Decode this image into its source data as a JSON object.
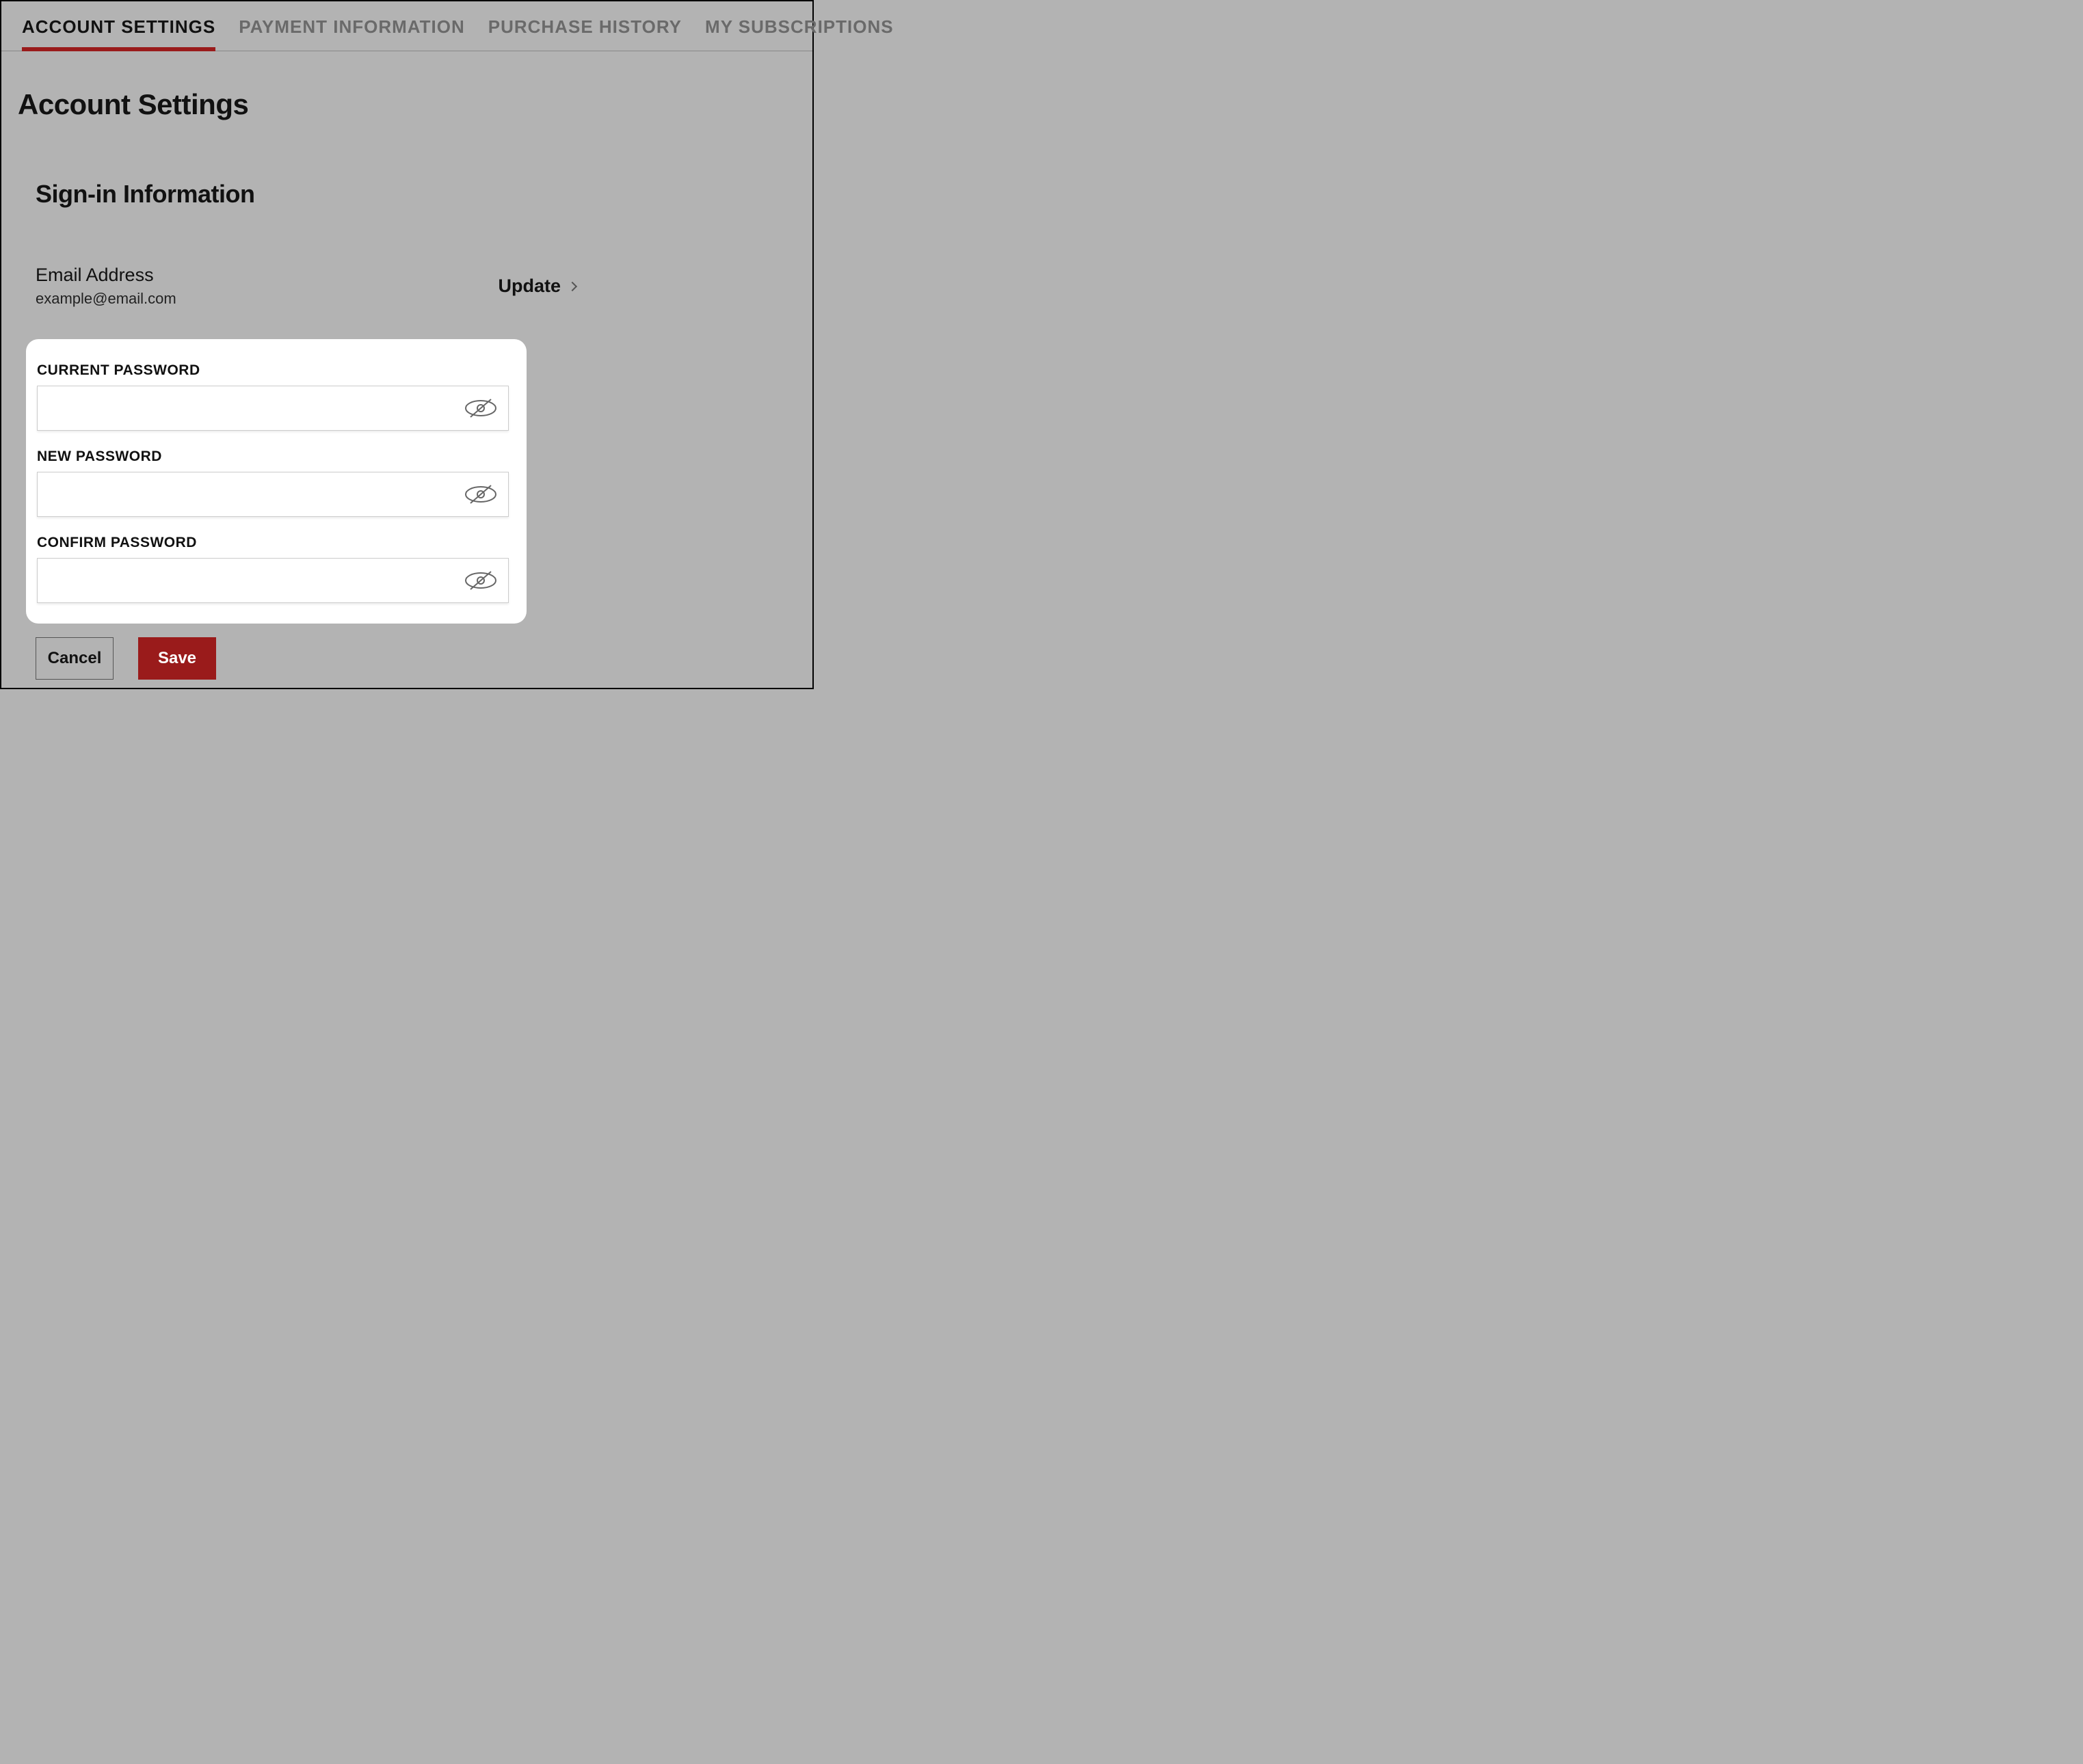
{
  "tabs": [
    {
      "label": "ACCOUNT SETTINGS",
      "active": true
    },
    {
      "label": "PAYMENT INFORMATION",
      "active": false
    },
    {
      "label": "PURCHASE HISTORY",
      "active": false
    },
    {
      "label": "MY SUBSCRIPTIONS",
      "active": false
    }
  ],
  "page": {
    "title": "Account Settings",
    "section_title": "Sign-in Information"
  },
  "email": {
    "label": "Email Address",
    "value": "example@email.com",
    "update_label": "Update"
  },
  "password_form": {
    "current_label": "CURRENT PASSWORD",
    "new_label": "NEW PASSWORD",
    "confirm_label": "CONFIRM PASSWORD",
    "current_value": "",
    "new_value": "",
    "confirm_value": ""
  },
  "buttons": {
    "cancel": "Cancel",
    "save": "Save"
  },
  "colors": {
    "accent": "#9a1b1b",
    "background": "#b3b3b3"
  }
}
